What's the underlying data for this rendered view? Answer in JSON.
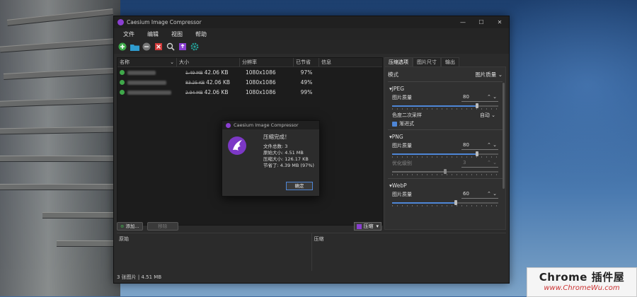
{
  "window": {
    "title": "Caesium Image Compressor",
    "minimize_glyph": "—",
    "maximize_glyph": "☐",
    "close_glyph": "✕"
  },
  "menu": [
    "文件",
    "编辑",
    "视图",
    "帮助"
  ],
  "toolbar": {
    "icons": [
      "add-icon",
      "folder-icon",
      "remove-icon",
      "clear-icon",
      "search-icon",
      "export-icon",
      "settings-icon"
    ],
    "colors": {
      "add": "#3fa84a",
      "folder": "#2f9ccf",
      "remove": "#777777",
      "clear": "#d23a3a",
      "search": "#cccccc",
      "export": "#8a3fd1",
      "settings": "#24a39a"
    }
  },
  "table": {
    "columns": [
      "名称",
      "大小",
      "分辨率",
      "已节省",
      "信息"
    ],
    "rows": [
      {
        "old_size": "1.49 MB",
        "new_size": "42.06 KB",
        "resolution": "1080x1086",
        "saved": "97%"
      },
      {
        "old_size": "83.25 KB",
        "new_size": "42.06 KB",
        "resolution": "1080x1086",
        "saved": "49%"
      },
      {
        "old_size": "2.94 MB",
        "new_size": "42.06 KB",
        "resolution": "1080x1086",
        "saved": "99%"
      }
    ]
  },
  "panel": {
    "tabs": [
      "压缩选项",
      "图片尺寸",
      "输出"
    ],
    "mode_label": "模式",
    "mode_value": "图片质量",
    "jpeg": {
      "title": "▾JPEG",
      "quality_label": "图片质量",
      "quality_value": "80",
      "quality_fraction": 0.8,
      "subsampling_label": "色度二次采样",
      "subsampling_value": "自动",
      "progressive_label": "渐进式"
    },
    "png": {
      "title": "▾PNG",
      "quality_label": "图片质量",
      "quality_value": "80",
      "quality_fraction": 0.8,
      "opt_label": "优化级别",
      "opt_value": "3",
      "opt_fraction": 0.5
    },
    "webp": {
      "title": "▾WebP",
      "quality_label": "图片质量",
      "quality_value": "60",
      "quality_fraction": 0.6
    }
  },
  "bottom": {
    "add_label": "添加...",
    "remove_label": "移除",
    "compress_label": "压缩"
  },
  "preview": {
    "original_label": "原始",
    "compressed_label": "压缩"
  },
  "status": "3 张图片 | 4.51 MB",
  "dialog": {
    "title": "Caesium Image Compressor",
    "heading": "压缩完成！",
    "files": "文件总数: 3",
    "original_size": "原始大小: 4.51 MB",
    "compressed_size": "压缩大小: 126.17 KB",
    "saved": "节省了: 4.39 MB (97%)",
    "ok_label": "确定"
  },
  "watermark": {
    "line1": "Chrome 插件屋",
    "line2": "www.ChromeWu.com"
  }
}
